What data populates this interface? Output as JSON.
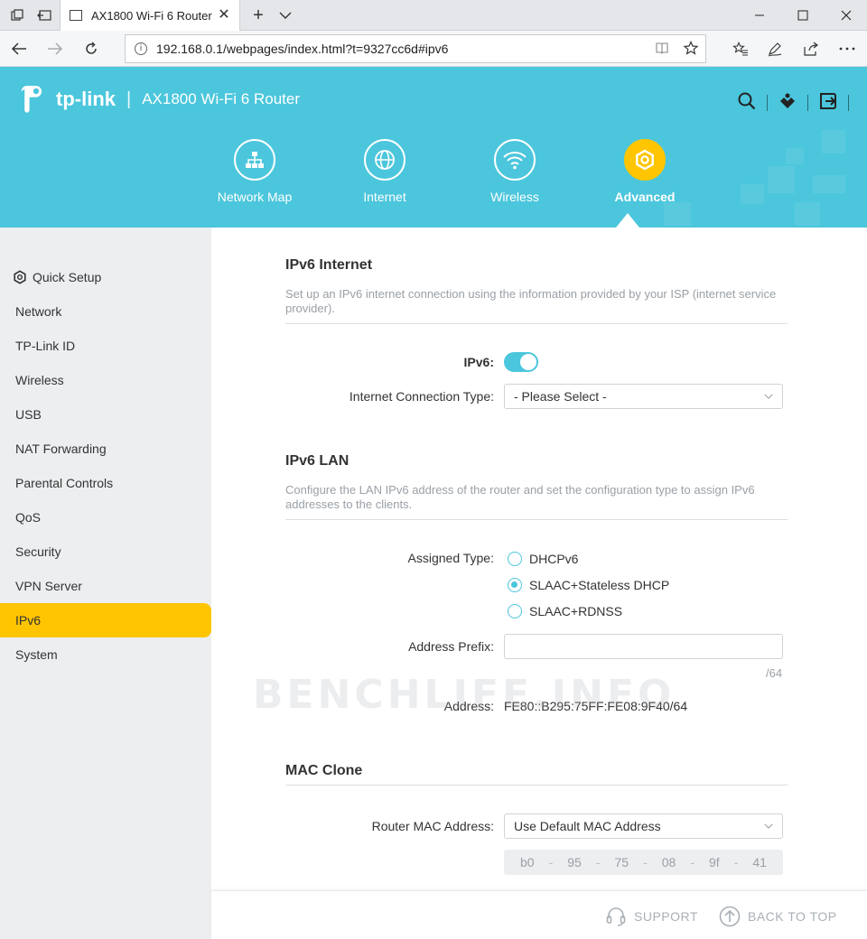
{
  "browser": {
    "tab_title": "AX1800 Wi-Fi 6 Router",
    "url": "192.168.0.1/webpages/index.html?t=9327cc6d#ipv6"
  },
  "header": {
    "brand": "tp-link",
    "separator": "|",
    "model": "AX1800 Wi-Fi 6 Router",
    "nav_tabs": [
      {
        "label": "Network Map",
        "icon": "network-map-icon"
      },
      {
        "label": "Internet",
        "icon": "globe-icon"
      },
      {
        "label": "Wireless",
        "icon": "wifi-icon"
      },
      {
        "label": "Advanced",
        "icon": "gear-icon",
        "active": true
      }
    ],
    "accent_color": "#4bc6dc",
    "active_color": "#ffc500"
  },
  "sidebar": {
    "items": [
      {
        "label": "Quick Setup",
        "icon": "gear-icon"
      },
      {
        "label": "Network"
      },
      {
        "label": "TP-Link ID"
      },
      {
        "label": "Wireless"
      },
      {
        "label": "USB"
      },
      {
        "label": "NAT Forwarding"
      },
      {
        "label": "Parental Controls"
      },
      {
        "label": "QoS"
      },
      {
        "label": "Security"
      },
      {
        "label": "VPN Server"
      },
      {
        "label": "IPv6",
        "active": true
      },
      {
        "label": "System"
      }
    ]
  },
  "ipv6_internet": {
    "title": "IPv6 Internet",
    "description": "Set up an IPv6 internet connection using the information provided by your ISP (internet service provider).",
    "ipv6_label": "IPv6:",
    "ipv6_enabled": true,
    "conn_type_label": "Internet Connection Type:",
    "conn_type_value": "- Please Select -"
  },
  "ipv6_lan": {
    "title": "IPv6 LAN",
    "description": "Configure the LAN IPv6 address of the router and set the configuration type to assign IPv6 addresses to the clients.",
    "assigned_type_label": "Assigned Type:",
    "options": [
      {
        "label": "DHCPv6",
        "selected": false
      },
      {
        "label": "SLAAC+Stateless DHCP",
        "selected": true
      },
      {
        "label": "SLAAC+RDNSS",
        "selected": false
      }
    ],
    "prefix_label": "Address Prefix:",
    "prefix_value": "",
    "prefix_suffix": "/64",
    "address_label": "Address:",
    "address_value": "FE80::B295:75FF:FE08:9F40/64"
  },
  "mac_clone": {
    "title": "MAC Clone",
    "router_mac_label": "Router MAC Address:",
    "router_mac_value": "Use Default MAC Address",
    "mac_octets": [
      "b0",
      "95",
      "75",
      "08",
      "9f",
      "41"
    ]
  },
  "watermark": "BENCHLIFE.INFO",
  "footer": {
    "support": "SUPPORT",
    "back_to_top": "BACK TO TOP"
  }
}
